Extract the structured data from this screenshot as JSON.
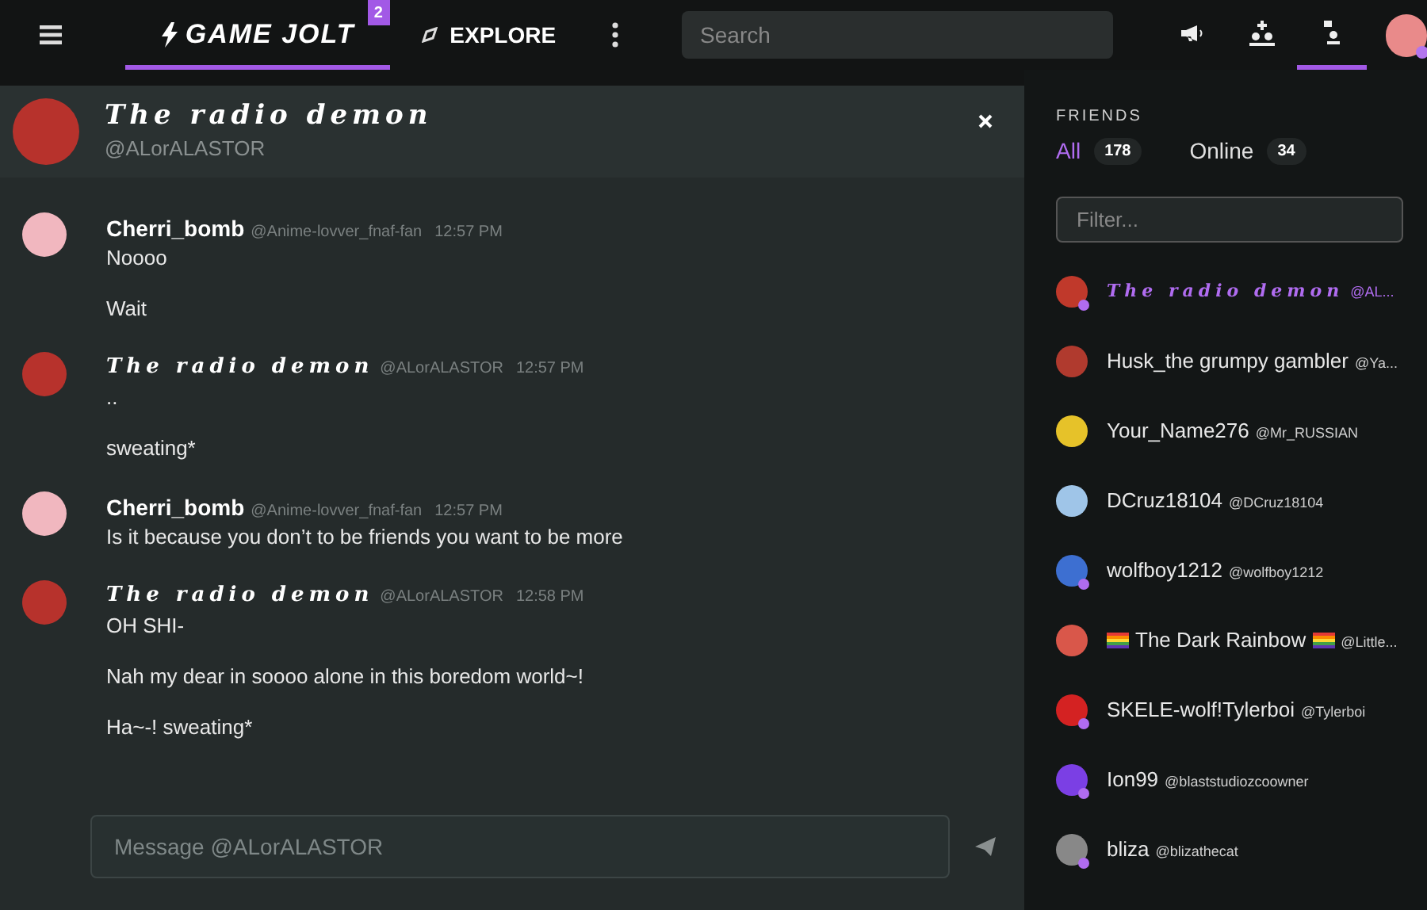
{
  "topbar": {
    "logo": "GAME JOLT",
    "logo_badge": "2",
    "explore": "EXPLORE",
    "search": {
      "placeholder": "Search"
    },
    "icons": [
      {
        "kind": "announce",
        "selected": false
      },
      {
        "kind": "add-friends",
        "selected": false
      },
      {
        "kind": "friends",
        "selected": true
      }
    ]
  },
  "chat": {
    "title": "The radio demon",
    "handle": "@ALorALASTOR",
    "messages": [
      {
        "author": "Cherri_bomb",
        "fancy": false,
        "handle": "@Anime-lovver_fnaf-fan",
        "time": "12:57 PM",
        "color": "#f1b7bf",
        "lines": [
          "Noooo",
          "Wait"
        ]
      },
      {
        "author": "The radio demon",
        "fancy": true,
        "handle": "@ALorALASTOR",
        "time": "12:57 PM",
        "color": "#b7322c",
        "lines": [
          "..",
          "sweating*"
        ]
      },
      {
        "author": "Cherri_bomb",
        "fancy": false,
        "handle": "@Anime-lovver_fnaf-fan",
        "time": "12:57 PM",
        "color": "#f1b7bf",
        "lines": [
          "Is it because you don’t to be friends you want to be more"
        ]
      },
      {
        "author": "The radio demon",
        "fancy": true,
        "handle": "@ALorALASTOR",
        "time": "12:58 PM",
        "color": "#b7322c",
        "lines": [
          "OH SHI-",
          "Nah my dear in soooo alone in this boredom world~!",
          "Ha~-! sweating*"
        ]
      }
    ],
    "input": {
      "placeholder": "Message @ALorALASTOR"
    }
  },
  "friends": {
    "heading": "FRIENDS",
    "tabs": [
      {
        "label": "All",
        "count": "178",
        "selected": true
      },
      {
        "label": "Online",
        "count": "34",
        "selected": false
      }
    ],
    "filter": {
      "placeholder": "Filter..."
    },
    "list": [
      {
        "name": "The radio demon",
        "handle": "@AL...",
        "fancy": true,
        "selected": true,
        "online": true,
        "color": "#c0392b",
        "flags": false
      },
      {
        "name": "Husk_the grumpy gambler",
        "handle": "@Ya...",
        "fancy": false,
        "selected": false,
        "online": false,
        "color": "#b03a2e",
        "flags": false
      },
      {
        "name": "Your_Name276",
        "handle": "@Mr_RUSSIAN",
        "fancy": false,
        "selected": false,
        "online": false,
        "color": "#e6c229",
        "flags": false
      },
      {
        "name": "DCruz18104",
        "handle": "@DCruz18104",
        "fancy": false,
        "selected": false,
        "online": false,
        "color": "#9fc5e8",
        "flags": false
      },
      {
        "name": "wolfboy1212",
        "handle": "@wolfboy1212",
        "fancy": false,
        "selected": false,
        "online": true,
        "color": "#3d6fd1",
        "flags": false
      },
      {
        "name": "The Dark Rainbow",
        "handle": "@Little...",
        "fancy": false,
        "selected": false,
        "online": false,
        "color": "#d9574a",
        "flags": true
      },
      {
        "name": "SKELE-wolf!Tylerboi",
        "handle": "@Tylerboi",
        "fancy": false,
        "selected": false,
        "online": true,
        "color": "#d42222",
        "flags": false
      },
      {
        "name": "Ion99",
        "handle": "@blaststudiozcoowner",
        "fancy": false,
        "selected": false,
        "online": true,
        "color": "#7b3fe4",
        "flags": false
      },
      {
        "name": "bliza",
        "handle": "@blizathecat",
        "fancy": false,
        "selected": false,
        "online": true,
        "color": "#888888",
        "flags": false
      }
    ]
  }
}
